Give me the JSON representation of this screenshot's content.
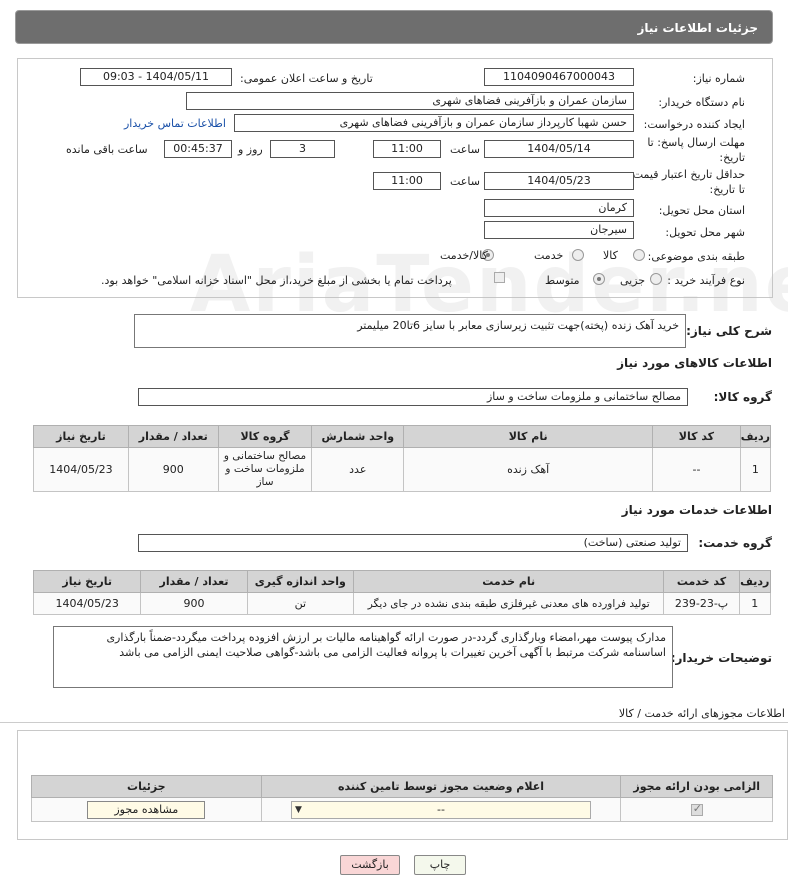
{
  "header": {
    "title": "جزئیات اطلاعات نیاز"
  },
  "form": {
    "need_number_label": "شماره نیاز:",
    "need_number": "1104090467000043",
    "announce_label": "تاریخ و ساعت اعلان عمومی:",
    "announce_value": "1404/05/11 - 09:03",
    "buyer_org_label": "نام دستگاه خریدار:",
    "buyer_org": "سازمان عمران و بازآفرینی فضاهای شهری",
    "creator_label": "ایجاد کننده درخواست:",
    "creator": "حسن شهبا کارپرداز سازمان عمران و بازآفرینی فضاهای شهری",
    "contact_link": "اطلاعات تماس خریدار",
    "deadline_label_1": "مهلت ارسال پاسخ: تا",
    "deadline_label_2": "تاریخ:",
    "deadline_date": "1404/05/14",
    "time_label": "ساعت",
    "deadline_time": "11:00",
    "days_value": "3",
    "days_label": "روز و",
    "remaining_value": "00:45:37",
    "remaining_label": "ساعت باقی مانده",
    "validity_label_1": "حداقل تاریخ اعتبار قیمت:",
    "validity_label_2": "تا تاریخ:",
    "validity_date": "1404/05/23",
    "validity_time": "11:00",
    "province_label": "استان محل تحویل:",
    "province": "کرمان",
    "city_label": "شهر محل تحویل:",
    "city": "سیرجان",
    "category_label": "طبقه بندی موضوعی:",
    "category_options": [
      "کالا",
      "خدمت",
      "کالا/خدمت"
    ],
    "process_label": "نوع فرآیند خرید :",
    "process_options": [
      "جزیی",
      "متوسط"
    ],
    "payment_text": "پرداخت تمام یا بخشی از مبلغ خرید،از محل \"اسناد خزانه اسلامی\" خواهد بود."
  },
  "description": {
    "label": "شرح کلی نیاز:",
    "text": "خرید آهک زنده (پخته)جهت تثبیت زیرسازی معابر با سایز 6تا20 میلیمتر"
  },
  "goods": {
    "section_title": "اطلاعات کالاهای مورد نیاز",
    "group_label": "گروه کالا:",
    "group_value": "مصالح ساختمانی و ملزومات ساخت و ساز",
    "columns": [
      "ردیف",
      "کد کالا",
      "نام کالا",
      "واحد شمارش",
      "گروه کالا",
      "تعداد / مقدار",
      "تاریخ نیاز"
    ],
    "rows": [
      [
        "1",
        "--",
        "آهک زنده",
        "عدد",
        "مصالح ساختمانی و ملزومات ساخت و ساز",
        "900",
        "1404/05/23"
      ]
    ]
  },
  "services": {
    "section_title": "اطلاعات خدمات مورد نیاز",
    "group_label": "گروه خدمت:",
    "group_value": "تولید صنعتی (ساخت)",
    "columns": [
      "ردیف",
      "کد خدمت",
      "نام خدمت",
      "واحد اندازه گیری",
      "تعداد / مقدار",
      "تاریخ نیاز"
    ],
    "rows": [
      [
        "1",
        "پ-23-239",
        "تولید فراورده های معدنی غیرفلزی طبقه بندی نشده در جای دیگر",
        "تن",
        "900",
        "1404/05/23"
      ]
    ]
  },
  "buyer_notes": {
    "label": "توضیحات خریدار:",
    "text": "مدارک پیوست مهر،امضاء وبارگذاری گردد-در صورت ارائه گواهینامه مالیات بر ارزش افزوده پرداخت میگردد-ضمناً بارگذاری اساسنامه شرکت مرتبط با آگهی آخرین تغییرات با پروانه فعالیت الزامی می باشد-گواهی صلاحیت ایمنی الزامی می باشد"
  },
  "permits": {
    "title": "اطلاعات مجوزهای ارائه خدمت / کالا",
    "columns": [
      "الزامی بودن ارائه مجوز",
      "اعلام وضعیت مجوز توسط تامین کننده",
      "جزئیات"
    ],
    "select_value": "--",
    "view_button": "مشاهده مجوز"
  },
  "footer": {
    "print_button": "چاپ",
    "back_button": "بازگشت"
  },
  "watermark": "AriaTender.neT"
}
